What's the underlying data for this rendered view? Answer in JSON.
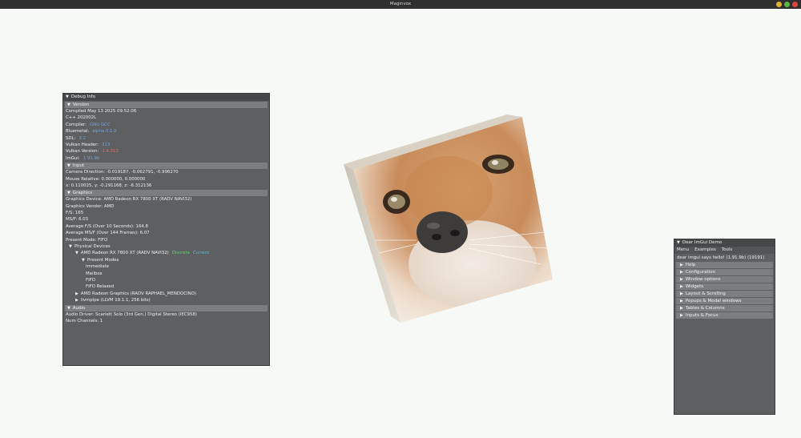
{
  "window": {
    "title": "Maginvox",
    "controls": [
      {
        "name": "minimize",
        "color": "#e6b02f"
      },
      {
        "name": "maximize",
        "color": "#5fb63f"
      },
      {
        "name": "close",
        "color": "#e0453a"
      }
    ]
  },
  "debug": {
    "title": "Debug Info",
    "version": {
      "header": "Version",
      "compiled": "Compiled May 13 2025 09:52:06",
      "cpp": "C++ 202002L",
      "compiler_label": "Compiler:",
      "compiler_value": "GNU GCC",
      "bluemetal_label": "Bluemetal:",
      "bluemetal_value": "alpha 0.1.0",
      "sdl_label": "SDL:",
      "sdl_value": "3.2",
      "vk_header_label": "Vulkan Header:",
      "vk_header_value": "313",
      "vk_version_label": "Vulkan Version:",
      "vk_version_value": "1.4.313",
      "imgui_label": "ImGui:",
      "imgui_value": "1.91.9b"
    },
    "input": {
      "header": "Input",
      "camera": "Camera Direction: -0.019187, -0.062791, -0.996270",
      "mouse": "Mouse Relative: 0.000000, 0.000000",
      "xyz": "x: 0.110025, y: -0.291168, z: -6.312136"
    },
    "graphics": {
      "header": "Graphics",
      "device": "Graphics Device: AMD Radeon RX 7800 XT (RADV NAVI32)",
      "vendor": "Graphics Vendor: AMD",
      "fps": "F/S: 165",
      "msf": "MS/F: 6.03",
      "avg_fps": "Average F/S (Over 10 Seconds): 164.8",
      "avg_msf": "Average MS/F (Over 144 Frames): 6.07",
      "present_mode": "Present Mode: FIFO",
      "physical_devices": "Physical Devices",
      "gpu1": "AMD Radeon RX 7800 XT (RADV NAVI32)",
      "gpu1_tag": "Discrete",
      "gpu1_current": "Current",
      "present_modes": "Present Modes",
      "modes": [
        "Immediate",
        "Mailbox",
        "FIFO",
        "FIFO Relaxed"
      ],
      "gpu2": "AMD Radeon Graphics (RADV RAPHAEL_MENDOCINO)",
      "gpu3": "llvmpipe (LLVM 19.1.1, 256 bits)"
    },
    "audio": {
      "header": "Audio",
      "driver": "Audio Driver: Scarlett Solo (3rd Gen.) Digital Stereo (IEC958)",
      "channels": "Num Channels: 1"
    }
  },
  "demo": {
    "title": "Dear ImGui Demo",
    "menu": [
      "Menu",
      "Examples",
      "Tools"
    ],
    "hello": "dear imgui says hello! (1.91.9b) (19191)",
    "sections": [
      "Help",
      "Configuration",
      "Window options",
      "Widgets",
      "Layout & Scrolling",
      "Popups & Modal windows",
      "Tables & Columns",
      "Inputs & Focus"
    ]
  }
}
